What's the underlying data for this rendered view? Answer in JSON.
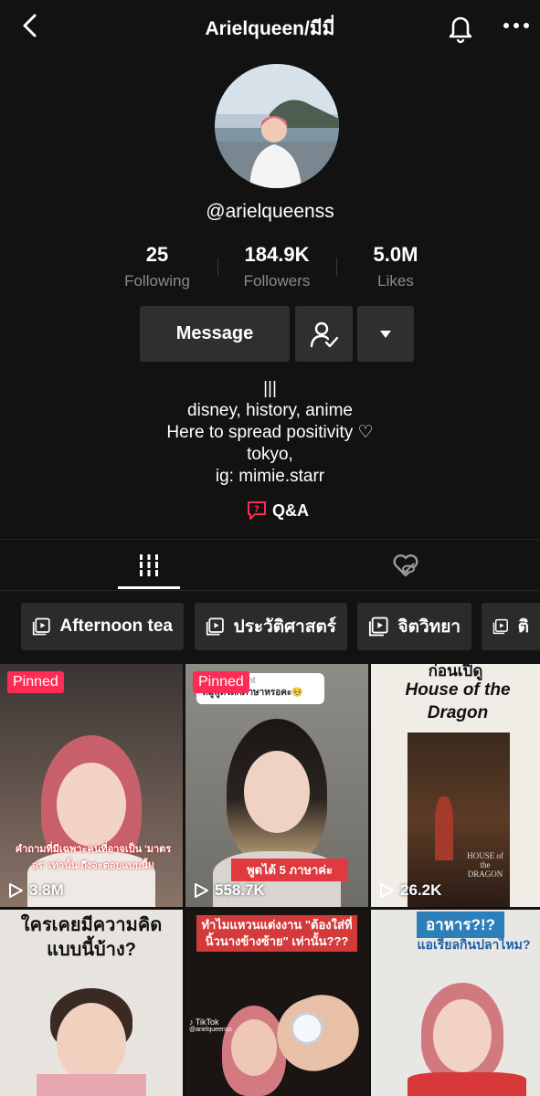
{
  "header": {
    "title": "Arielqueen/มีมี่",
    "icons": [
      "back-chevron-icon",
      "bell-icon",
      "more-icon"
    ]
  },
  "profile": {
    "username": "@arielqueenss"
  },
  "stats": [
    {
      "value": "25",
      "label": "Following"
    },
    {
      "value": "184.9K",
      "label": "Followers"
    },
    {
      "value": "5.0M",
      "label": "Likes"
    }
  ],
  "actions": {
    "message": "Message"
  },
  "bio": {
    "lines": [
      "|||",
      "disney, history, anime",
      "Here to spread positivity ♡",
      "tokyo,",
      "ig: mimie.starr"
    ]
  },
  "qa": {
    "label": "Q&A"
  },
  "playlists": [
    "Afternoon tea",
    "ประวัติศาสตร์",
    "จิตวิทยา",
    "ติ"
  ],
  "videos": [
    {
      "views": "3.8M",
      "pinned": "Pinned",
      "caption": "คำถามที่มีเฉพาะคนที่อาจเป็น 'มาตรอร' เท่านั้น ถึงจะตอบแบบนี้!!"
    },
    {
      "views": "558.7K",
      "pinned": "Pinned",
      "caption": "พูดได้ 5 ภาษาค่ะ",
      "reply_top": "st's comment",
      "reply_text": "หมูพูดได้กี่ภาษาหรอคะ🥺"
    },
    {
      "views": "26.2K",
      "caption_top": "ก่อนเปิดู",
      "caption_title": "House of the Dragon",
      "poster_text": "HOUSE of the DRAGON"
    },
    {
      "caption": "ใครเคยมีความคิด แบบนี้บ้าง?"
    },
    {
      "caption": "ทำไมแหวนแต่งงาน \"ต้องใส่ที่นิ้วนางข้างซ้าย\" เท่านั้น???",
      "watermark": "TikTok",
      "watermark_handle": "@arielqueenss"
    },
    {
      "caption_top": "อาหาร?!?",
      "caption": "แอเรียลกินปลาไหม?"
    }
  ],
  "colors": {
    "background": "#121212",
    "button": "#2f2f2f",
    "pinned": "#fe2c55",
    "qa_icon": "#fe2c55"
  }
}
